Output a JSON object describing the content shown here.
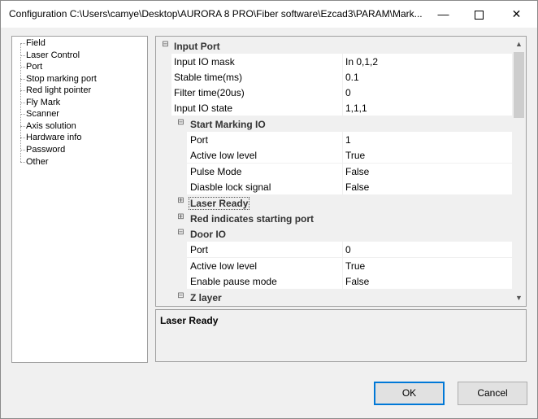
{
  "window": {
    "title": "Configuration C:\\Users\\camye\\Desktop\\AURORA 8 PRO\\Fiber software\\Ezcad3\\PARAM\\Mark...",
    "minimize_glyph": "—",
    "close_glyph": "✕"
  },
  "tree": {
    "items": [
      "Field",
      "Laser Control",
      "Port",
      "Stop marking port",
      "Red light pointer",
      "Fly Mark",
      "Scanner",
      "Axis solution",
      "Hardware info",
      "Password",
      "Other"
    ]
  },
  "grid": {
    "input_port": {
      "label": "Input Port",
      "props": [
        {
          "name": "Input IO mask",
          "value": "In 0,1,2"
        },
        {
          "name": "Stable time(ms)",
          "value": "0.1"
        },
        {
          "name": "Filter time(20us)",
          "value": "0"
        },
        {
          "name": "Input IO state",
          "value": " 1,1,1"
        }
      ]
    },
    "start_marking": {
      "label": "Start Marking IO",
      "props": [
        {
          "name": "Port",
          "value": "1"
        },
        {
          "name": "Active low level",
          "value": "True"
        },
        {
          "name": "Pulse Mode",
          "value": "False"
        },
        {
          "name": "Diasble lock signal",
          "value": "False"
        }
      ]
    },
    "laser_ready": {
      "label": "Laser Ready"
    },
    "red_start": {
      "label": "Red indicates starting port"
    },
    "door_io": {
      "label": "Door IO",
      "props": [
        {
          "name": "Port",
          "value": "0"
        },
        {
          "name": "Active low level",
          "value": "True"
        },
        {
          "name": "Enable pause mode",
          "value": "False"
        }
      ]
    },
    "z_layer": {
      "label": "Z layer"
    },
    "expand_glyph": "⊞",
    "collapse_glyph": "⊟"
  },
  "description": {
    "title": "Laser Ready"
  },
  "buttons": {
    "ok": "OK",
    "cancel": "Cancel"
  }
}
